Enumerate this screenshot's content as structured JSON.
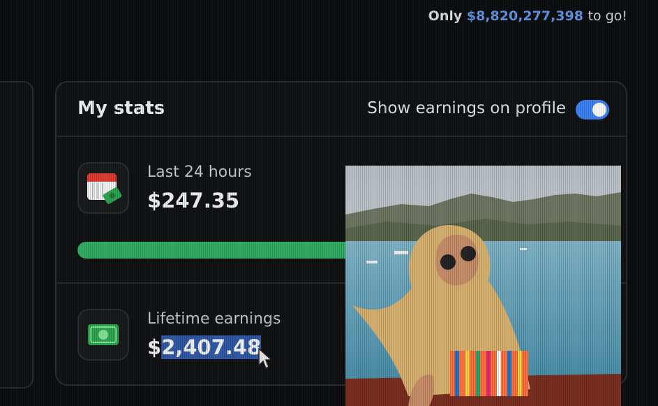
{
  "goal": {
    "prefix": "Only",
    "amount": "$8,820,277,398",
    "suffix": "to go!"
  },
  "stats": {
    "title": "My stats",
    "toggle_label": "Show earnings on profile",
    "toggle_on": true,
    "last24": {
      "label": "Last 24 hours",
      "value": "$247.35",
      "progress": 0.7,
      "icon": "calendar-money-icon"
    },
    "lifetime": {
      "label": "Lifetime earnings",
      "value_prefix": "$",
      "value_selected": "2,407.48",
      "icon": "cash-icon"
    }
  },
  "colors": {
    "accent": "#3b82f6",
    "goal_amount": "#5f95e6",
    "progress": "#2fae62",
    "selection": "#2f58a6"
  },
  "overlay": {
    "icon": "person-photo"
  }
}
